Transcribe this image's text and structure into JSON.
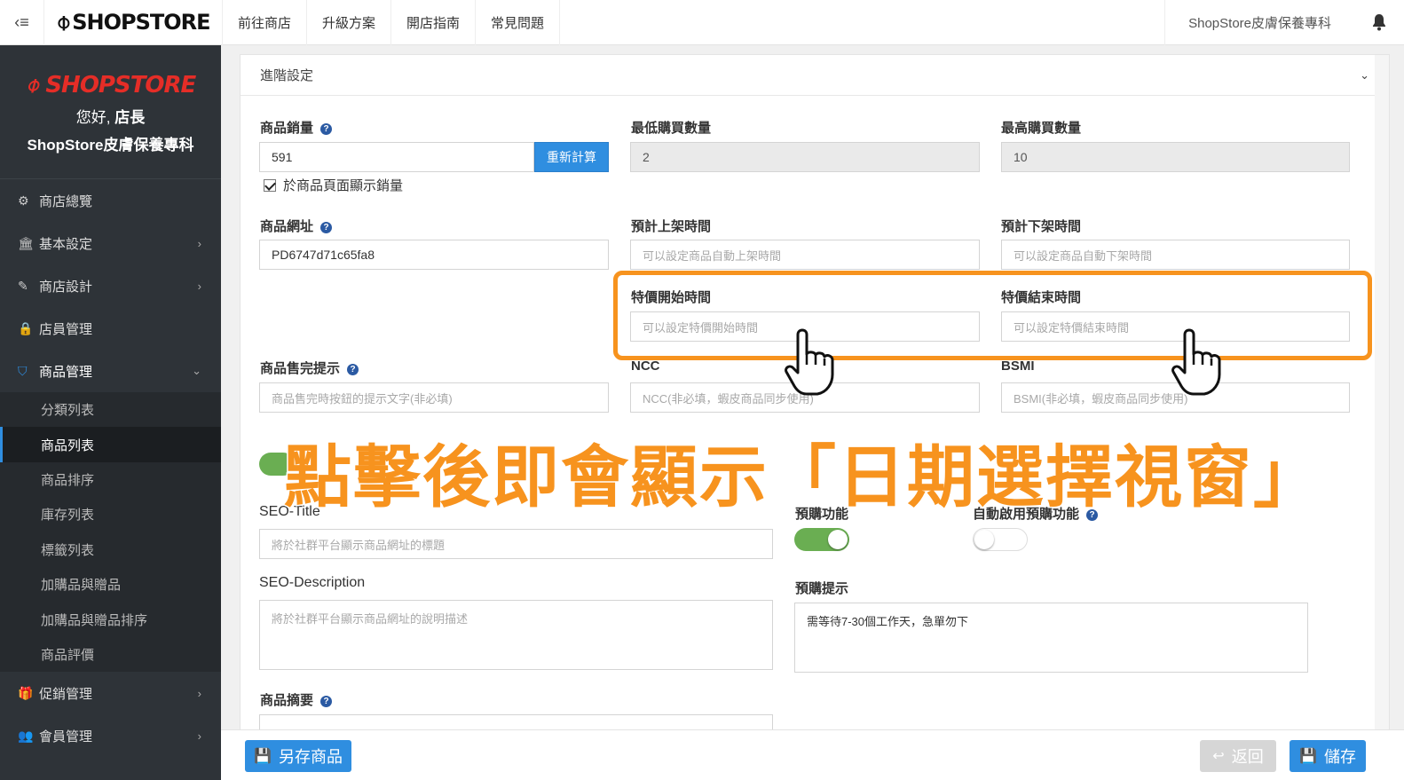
{
  "topbar": {
    "menu_icon": "‹≡",
    "brand": "SHOPSTORE",
    "nav": [
      "前往商店",
      "升級方案",
      "開店指南",
      "常見問題"
    ],
    "store_name": "ShopStore皮膚保養專科"
  },
  "sidebar": {
    "logo": "SHOPSTORE",
    "greeting_prefix": "您好, ",
    "greeting_name": "店長",
    "store": "ShopStore皮膚保養專科",
    "items": [
      {
        "label": "商店總覽",
        "icon": "⚙",
        "chevron": ""
      },
      {
        "label": "基本設定",
        "icon": "🏛",
        "chevron": "›"
      },
      {
        "label": "商店設計",
        "icon": "✎",
        "chevron": "›"
      },
      {
        "label": "店員管理",
        "icon": "🔒",
        "chevron": ""
      },
      {
        "label": "商品管理",
        "icon": "⛉",
        "chevron": "⌄"
      }
    ],
    "subitems": [
      "分類列表",
      "商品列表",
      "商品排序",
      "庫存列表",
      "標籤列表",
      "加購品與贈品",
      "加購品與贈品排序",
      "商品評價"
    ],
    "items_after": [
      {
        "label": "促銷管理",
        "icon": "🎁",
        "chevron": "›"
      },
      {
        "label": "會員管理",
        "icon": "👥",
        "chevron": "›"
      }
    ]
  },
  "panel": {
    "title": "進階設定",
    "toggle_icon": "⌄",
    "sales": {
      "label": "商品銷量",
      "value": "591",
      "recalc": "重新計算",
      "show_label": "於商品頁面顯示銷量"
    },
    "min_qty": {
      "label": "最低購買數量",
      "value": "2"
    },
    "max_qty": {
      "label": "最高購買數量",
      "value": "10"
    },
    "url": {
      "label": "商品網址",
      "value": "PD6747d71c65fa8"
    },
    "launch_time": {
      "label": "預計上架時間",
      "placeholder": "可以設定商品自動上架時間"
    },
    "offshelf_time": {
      "label": "預計下架時間",
      "placeholder": "可以設定商品自動下架時間"
    },
    "special_start": {
      "label": "特價開始時間",
      "placeholder": "可以設定特價開始時間"
    },
    "special_end": {
      "label": "特價結束時間",
      "placeholder": "可以設定特價結束時間"
    },
    "soldout": {
      "label": "商品售完提示",
      "placeholder": "商品售完時按鈕的提示文字(非必填)"
    },
    "ncc": {
      "label": "NCC",
      "placeholder": "NCC(非必填，蝦皮商品同步使用)"
    },
    "bsmi": {
      "label": "BSMI",
      "placeholder": "BSMI(非必填，蝦皮商品同步使用)"
    },
    "seo_title": {
      "label": "SEO-Title",
      "placeholder": "將於社群平台顯示商品網址的標題"
    },
    "seo_desc": {
      "label": "SEO-Description",
      "placeholder": "將於社群平台顯示商品網址的說明描述"
    },
    "preorder": {
      "label": "預購功能"
    },
    "auto_preorder": {
      "label": "自動啟用預購功能"
    },
    "preorder_hint": {
      "label": "預購提示",
      "value": "需等待7-30個工作天，急單勿下"
    },
    "summary": {
      "label": "商品摘要"
    }
  },
  "overlay": {
    "text": "點擊後即會顯示「日期選擇視窗」"
  },
  "bottom": {
    "save_as": "另存商品",
    "back": "返回",
    "save": "儲存"
  },
  "colors": {
    "accent": "#f7931e",
    "primary": "#2f8ee0",
    "toggle_on": "#6aae52",
    "sidebar": "#2e3338",
    "logo_red": "#e52d27"
  }
}
